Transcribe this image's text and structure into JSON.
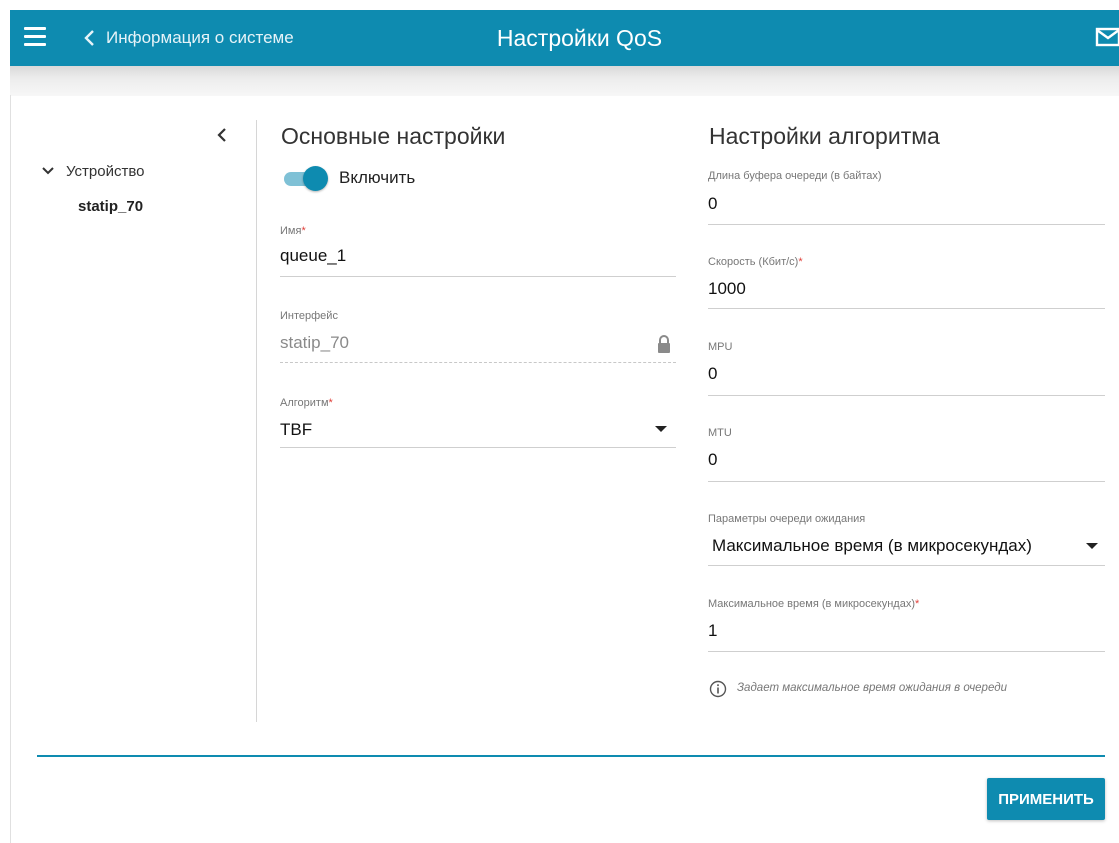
{
  "header": {
    "back_label": "Информация о системе",
    "title": "Настройки QoS",
    "icons": {
      "menu": "hamburger-icon",
      "back": "chevron-left-icon",
      "mail": "mail-icon"
    }
  },
  "sidebar": {
    "group_label": "Устройство",
    "items": [
      {
        "label": "statip_70"
      }
    ]
  },
  "basic": {
    "title": "Основные настройки",
    "enable": {
      "label": "Включить",
      "on": true
    },
    "name": {
      "label": "Имя",
      "required": "*",
      "value": "queue_1"
    },
    "interface": {
      "label": "Интерфейс",
      "value": "statip_70",
      "locked": true
    },
    "algorithm": {
      "label": "Алгоритм",
      "required": "*",
      "value": "TBF"
    }
  },
  "algo": {
    "title": "Настройки алгоритма",
    "buffer": {
      "label": "Длина буфера очереди (в байтах)",
      "value": "0"
    },
    "rate": {
      "label": "Скорость (Кбит/с)",
      "required": "*",
      "value": "1000"
    },
    "mpu": {
      "label": "MPU",
      "value": "0"
    },
    "mtu": {
      "label": "MTU",
      "value": "0"
    },
    "queue_params": {
      "label": "Параметры очереди ожидания",
      "value": "Максимальное время (в микросекундах)"
    },
    "max_time": {
      "label": "Максимальное время (в микросекундах)",
      "required": "*",
      "value": "1"
    },
    "hint": "Задает максимальное время ожидания в очереди"
  },
  "actions": {
    "apply_label": "ПРИМЕНИТЬ"
  },
  "colors": {
    "accent": "#0e8bb0",
    "required": "#e0403a"
  }
}
